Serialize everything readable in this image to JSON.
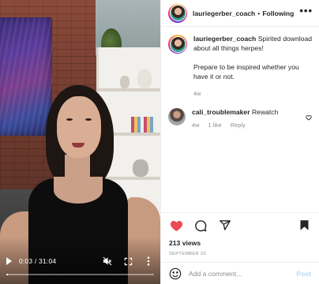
{
  "video": {
    "current_time": "0:03",
    "duration": "31:04",
    "time_separator": " / ",
    "progress_fraction": 0.002
  },
  "header": {
    "username": "lauriegerber_coach",
    "separator": "•",
    "follow_state": "Following",
    "more_label": "•••"
  },
  "caption": {
    "username": "lauriegerber_coach",
    "text_1": "Spirited download about all things herpes!",
    "text_2": "Prepare to be inspired whether you have it or not.",
    "age": "4w"
  },
  "comments": [
    {
      "username": "cali_troublemaker",
      "text": "Rewatch",
      "age": "4w",
      "likes": "1 like",
      "reply_label": "Reply"
    }
  ],
  "stats": {
    "views": "213 views",
    "date": "SEPTEMBER 20"
  },
  "add_comment": {
    "placeholder": "Add a comment...",
    "post_label": "Post"
  },
  "colors": {
    "liked_heart": "#ed4956",
    "post_disabled": "#b3dbff",
    "muted_text": "#8e8e8e"
  },
  "icons": [
    "play-icon",
    "mute-icon",
    "fullscreen-icon",
    "more-vert-icon",
    "heart-icon",
    "comment-icon",
    "share-icon",
    "bookmark-icon",
    "emoji-icon"
  ]
}
